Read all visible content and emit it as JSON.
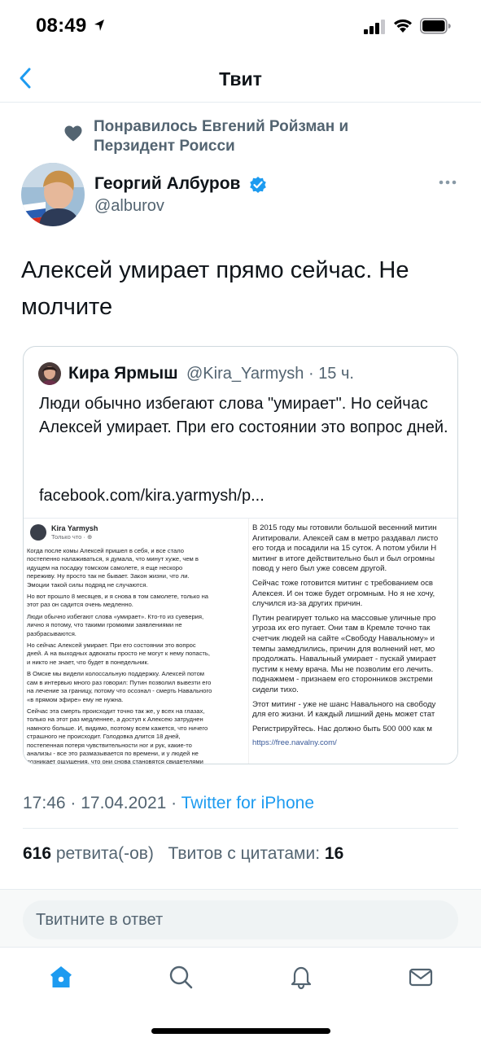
{
  "status_bar": {
    "time": "08:49",
    "icons": [
      "location-arrow-icon",
      "signal-icon",
      "wifi-icon",
      "battery-icon"
    ]
  },
  "nav": {
    "back_icon": "chevron-left-icon",
    "title": "Твит"
  },
  "social_context": {
    "icon": "heart-icon",
    "text": "Понравилось Евгений Ройзман и Перзидент Роисси"
  },
  "author": {
    "name": "Георгий Албуров",
    "handle": "@alburov",
    "verified": true
  },
  "tweet": {
    "text": "Алексей умирает прямо сейчас. Не молчите",
    "timestamp": "17:46 · 17.04.2021 · ",
    "source": "Twitter for iPhone"
  },
  "quoted_tweet": {
    "name": "Кира Ярмыш",
    "handle_time": "@Kira_Yarmysh · 15 ч.",
    "text": "Люди обычно избегают слова \"умирает\". Но сейчас Алексей умирает. При его состоянии это вопрос дней.",
    "link": "facebook.com/kira.yarmysh/p...",
    "image": {
      "fb_author": "Kira Yarmysh",
      "fb_time": "Только что · ",
      "left_paragraphs": [
        "Когда после комы Алексей пришел в себя, и все стало\nпостепенно налаживаться, я думала, что минут хуже, чем в\nидущем на посадку томском самолете, я еще нескоро\nпереживу. Ну просто так не бывает. Закон жизни, что ли.\nЭмоции такой силы подряд не случаются.",
        "Но вот прошло 8 месяцев, и я снова в том самолете, только на\nэтот раз он садится очень медленно.",
        "Люди обычно избегают слова «умирает». Кто-то из суеверия,\nлично я потому, что такими громкими заявлениями не\nразбрасываются.",
        "Но сейчас Алексей умирает. При его состоянии это вопрос\nдней. А на выходных адвокаты просто не могут к нему попасть,\nи никто не знает, что будет в понедельник.",
        "В Омске мы видели колоссальную поддержку. Алексей потом\nсам в интервью много раз говорил: Путин позволил вывезти его\nна лечение за границу, потому что осознал - смерть Навального\n«в прямом эфире» ему не нужна.",
        "Сейчас эта смерть происходит точно так же, у всех на глазах,\nтолько на этот раз медленнее, а доступ к Алексею затруднен\nнамного больше. И, видимо, поэтому всем кажется, что ничего\nстрашного не происходит. Голодовка длится 18 дней,\nпостепенная потеря чувствительности ног и рук, какие-то\nанализы - все это размазывается по времени, и у людей не\nвозникает ощущения, что они снова становятся свидетелями"
      ],
      "right_paragraphs": [
        "В 2015 году мы готовили большой весенний митин\nАгитировали. Алексей сам в метро раздавал листо\nего тогда и посадили на 15 суток. А потом убили Н\nмитинг в итоге действительно был и был огромны\nповод у него был уже совсем другой.",
        "Сейчас тоже готовится митинг с требованием осв\nАлексея. И он тоже будет огромным. Но я не хочу,\nслучился из-за других причин.",
        "Путин реагирует только на массовые уличные про\nугроза их его пугает. Они там в Кремле точно так\nсчетчик людей на сайте «Свободу Навальному» и\nтемпы замедлились, причин для волнений нет, мо\nпродолжать. Навальный умирает - пускай умирает\nпустим к нему врача. Мы не позволим его лечить.\nподнажмем - признаем его сторонников экстреми\nсидели тихо.",
        "Этот митинг - уже не шанс Навального на свободу\nдля его жизни. И каждый лишний день может стат",
        "Регистрируйтесь. Нас должно быть 500 000 как м"
      ],
      "right_url": "https://free.navalny.com/"
    }
  },
  "stats": {
    "retweets_count": "616",
    "retweets_label": " ретвита(-ов)",
    "quotes_label": "Твитов с цитатами: ",
    "quotes_count": "16"
  },
  "reply": {
    "placeholder": "Твитните в ответ"
  },
  "tabbar": {
    "tabs": [
      "home-icon",
      "search-icon",
      "notifications-icon",
      "messages-icon"
    ]
  },
  "colors": {
    "accent": "#1d9bf0",
    "secondary_text": "#536471",
    "primary_text": "#0f1419"
  }
}
